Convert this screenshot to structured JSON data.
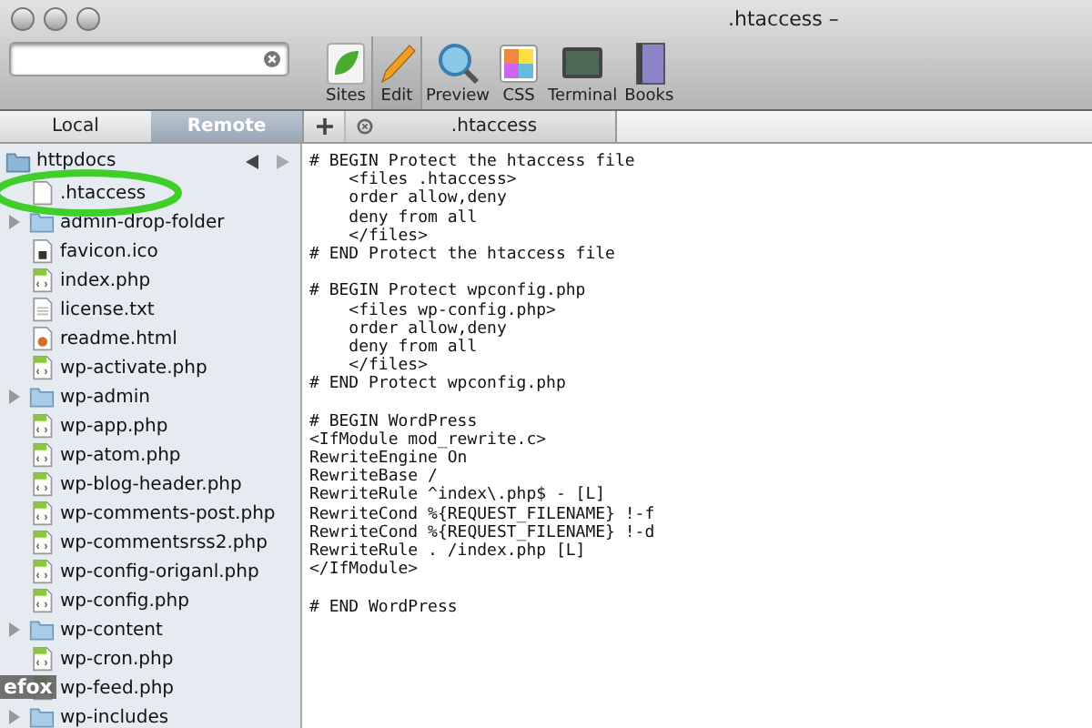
{
  "window": {
    "title": ".htaccess –"
  },
  "toolbar": [
    {
      "label": "Sites",
      "kind": "sites",
      "selected": false
    },
    {
      "label": "Edit",
      "kind": "edit",
      "selected": true
    },
    {
      "label": "Preview",
      "kind": "preview",
      "selected": false
    },
    {
      "label": "CSS",
      "kind": "css",
      "selected": false
    },
    {
      "label": "Terminal",
      "kind": "terminal",
      "selected": false
    },
    {
      "label": "Books",
      "kind": "books",
      "selected": false
    }
  ],
  "side_tabs": [
    {
      "label": "Local",
      "selected": false
    },
    {
      "label": "Remote",
      "selected": true
    }
  ],
  "editor_tabs": [
    {
      "label": ".htaccess",
      "selected": true
    }
  ],
  "path": {
    "label": "httpdocs"
  },
  "files": [
    {
      "name": ".htaccess",
      "kind": "file"
    },
    {
      "name": "admin-drop-folder",
      "kind": "folder"
    },
    {
      "name": "favicon.ico",
      "kind": "ico"
    },
    {
      "name": "index.php",
      "kind": "php"
    },
    {
      "name": "license.txt",
      "kind": "text"
    },
    {
      "name": "readme.html",
      "kind": "html"
    },
    {
      "name": "wp-activate.php",
      "kind": "php"
    },
    {
      "name": "wp-admin",
      "kind": "folder"
    },
    {
      "name": "wp-app.php",
      "kind": "php"
    },
    {
      "name": "wp-atom.php",
      "kind": "php"
    },
    {
      "name": "wp-blog-header.php",
      "kind": "php"
    },
    {
      "name": "wp-comments-post.php",
      "kind": "php"
    },
    {
      "name": "wp-commentsrss2.php",
      "kind": "php"
    },
    {
      "name": "wp-config-origanl.php",
      "kind": "php"
    },
    {
      "name": "wp-config.php",
      "kind": "php"
    },
    {
      "name": "wp-content",
      "kind": "folder"
    },
    {
      "name": "wp-cron.php",
      "kind": "php"
    },
    {
      "name": "wp-feed.php",
      "kind": "php"
    },
    {
      "name": "wp-includes",
      "kind": "folder"
    }
  ],
  "code_blocks": [
    [
      "# BEGIN Protect the htaccess file",
      "    <files .htaccess>",
      "    order allow,deny",
      "    deny from all",
      "    </files>",
      "# END Protect the htaccess file"
    ],
    [
      "# BEGIN Protect wpconfig.php",
      "    <files wp-config.php>",
      "    order allow,deny",
      "    deny from all",
      "    </files>",
      "# END Protect wpconfig.php"
    ],
    [
      "# BEGIN WordPress",
      "<IfModule mod_rewrite.c>",
      "RewriteEngine On",
      "RewriteBase /",
      "RewriteRule ^index\\.php$ - [L]",
      "RewriteCond %{REQUEST_FILENAME} !-f",
      "RewriteCond %{REQUEST_FILENAME} !-d",
      "RewriteRule . /index.php [L]",
      "</IfModule>"
    ],
    [
      "# END WordPress"
    ]
  ],
  "dock_label": "efox"
}
